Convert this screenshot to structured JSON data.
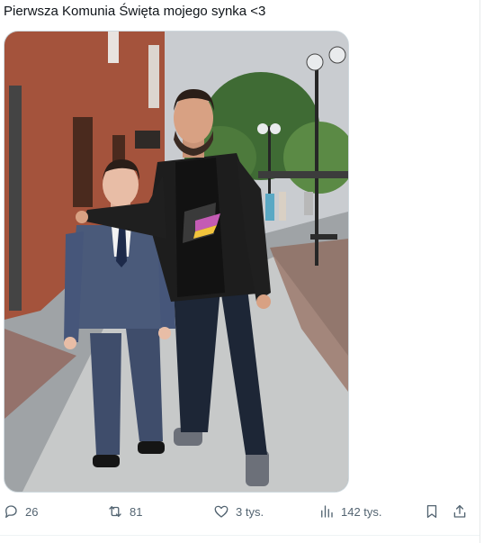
{
  "tweet": {
    "text": "Pierwsza Komunia Święta mojego synka <3"
  },
  "media": {
    "description_icon": "photo-image"
  },
  "actions": {
    "reply": {
      "icon": "reply-icon",
      "count": "26"
    },
    "retweet": {
      "icon": "retweet-icon",
      "count": "81"
    },
    "like": {
      "icon": "heart-icon",
      "count": "3 tys."
    },
    "views": {
      "icon": "views-chart-icon",
      "count": "142 tys."
    },
    "bookmark": {
      "icon": "bookmark-icon"
    },
    "share": {
      "icon": "share-icon"
    }
  },
  "colors": {
    "text": "#0f1419",
    "muted": "#536471",
    "border": "#cfd9de"
  }
}
